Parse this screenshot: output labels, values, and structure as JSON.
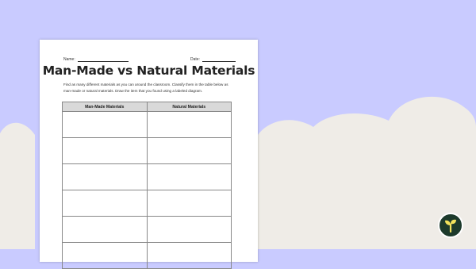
{
  "worksheet": {
    "name_label": "Name:",
    "date_label": "Date:",
    "title": "Man-Made vs Natural Materials",
    "instructions": "Find as many different materials as you can around the classroom. Classify them in the table below as man-made or natural materials. Draw the item that you found using a labeled diagram.",
    "table": {
      "headers": [
        "Man-Made Materials",
        "Natural Materials"
      ],
      "row_count": 6
    }
  },
  "logo": {
    "icon": "sprout-icon",
    "color": "#1d3a2c"
  },
  "colors": {
    "background": "#c9cbff",
    "clouds": "#efece7",
    "header_fill": "#d9d9d9"
  }
}
